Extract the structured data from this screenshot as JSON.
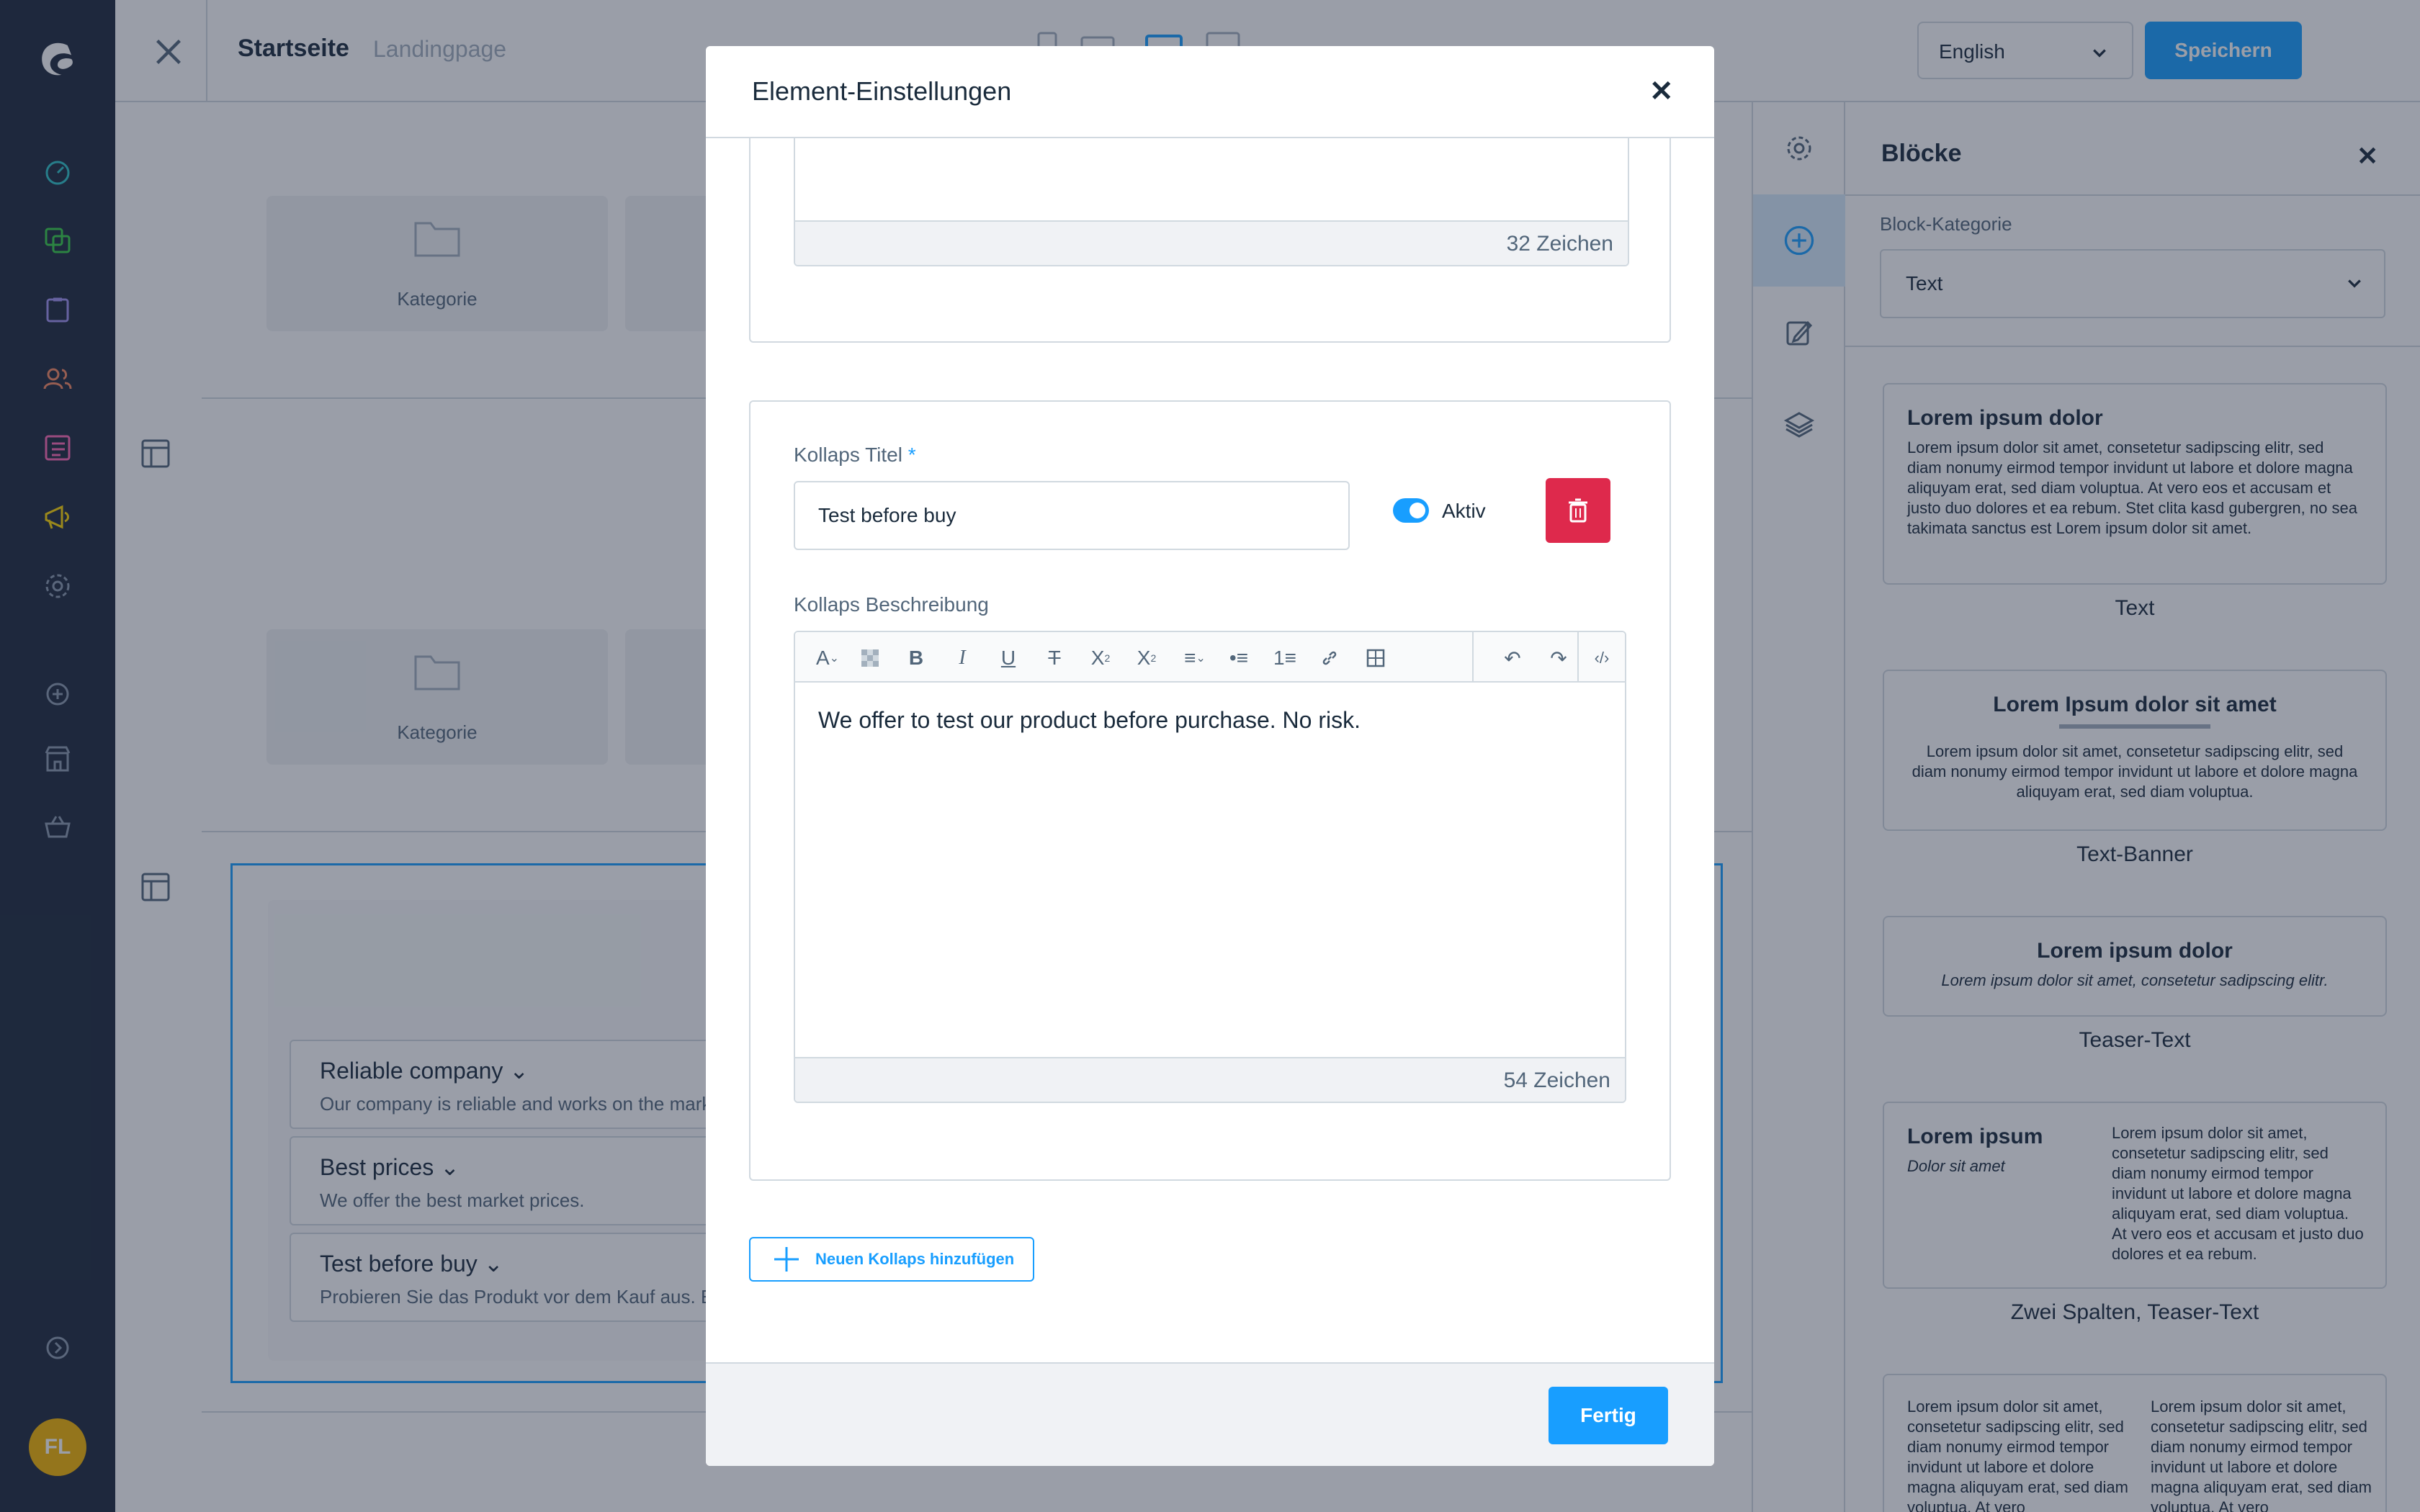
{
  "header": {
    "title": "Startseite",
    "subtitle": "Landingpage",
    "language": "English",
    "save_label": "Speichern"
  },
  "sidebar": {
    "avatar_initials": "FL",
    "icons": [
      "dashboard-icon",
      "catalogue-icon",
      "orders-icon",
      "customers-icon",
      "content-icon",
      "marketing-icon",
      "settings-icon",
      "add-extension-icon",
      "store-icon",
      "basket-icon",
      "collapse-icon"
    ]
  },
  "canvas": {
    "category_label": "Kategorie",
    "faq_items": [
      {
        "title": "Reliable company",
        "desc": "Our company is reliable and works on the marke"
      },
      {
        "title": "Best prices",
        "desc": "We offer the best market prices."
      },
      {
        "title": "Test before buy",
        "desc": "Probieren Sie das Produkt vor dem Kauf aus. Es g"
      }
    ]
  },
  "blocks_panel": {
    "title": "Blöcke",
    "category_label": "Block-Kategorie",
    "category_value": "Text",
    "cards": [
      {
        "heading": "Lorem ipsum dolor",
        "body": "Lorem ipsum dolor sit amet, consetetur sadipscing elitr, sed diam nonumy eirmod tempor invidunt ut labore et dolore magna aliquyam erat, sed diam voluptua. At vero eos et accusam et justo duo dolores et ea rebum. Stet clita kasd gubergren, no sea takimata sanctus est Lorem ipsum dolor sit amet.",
        "name": "Text"
      },
      {
        "heading": "Lorem Ipsum dolor sit amet",
        "body": "Lorem ipsum dolor sit amet, consetetur sadipscing elitr, sed diam nonumy eirmod tempor invidunt ut labore et dolore magna aliquyam erat, sed diam voluptua.",
        "name": "Text-Banner"
      },
      {
        "heading": "Lorem ipsum dolor",
        "body": "Lorem ipsum dolor sit amet, consetetur sadipscing elitr.",
        "name": "Teaser-Text"
      },
      {
        "heading": "Lorem ipsum",
        "subheading": "Dolor sit amet",
        "body": "Lorem ipsum dolor sit amet, consetetur sadipscing elitr, sed diam nonumy eirmod tempor invidunt ut labore et dolore magna aliquyam erat, sed diam voluptua. At vero eos et accusam et justo duo dolores et ea rebum.",
        "name": "Zwei Spalten, Teaser-Text"
      },
      {
        "col1": "Lorem ipsum dolor sit amet, consetetur sadipscing elitr, sed diam nonumy eirmod tempor invidunt ut labore et dolore magna aliquyam erat, sed diam voluptua. At vero",
        "col2": "Lorem ipsum dolor sit amet, consetetur sadipscing elitr, sed diam nonumy eirmod tempor invidunt ut labore et dolore magna aliquyam erat, sed diam voluptua. At vero"
      }
    ]
  },
  "modal": {
    "title": "Element-Einstellungen",
    "prev_char_count": "32 Zeichen",
    "collapse_title_label": "Kollaps Titel",
    "required_mark": "*",
    "collapse_title_value": "Test before buy",
    "active_label": "Aktiv",
    "active": true,
    "description_label": "Kollaps Beschreibung",
    "description_value": "We offer to test our product before purchase. No risk.",
    "char_count": "54 Zeichen",
    "add_collapse_label": "Neuen Kollaps hinzufügen",
    "done_label": "Fertig"
  },
  "colors": {
    "accent": "#189eff",
    "danger": "#de294c",
    "sidebar_bg": "#1e293d",
    "avatar": "#f4b400"
  }
}
